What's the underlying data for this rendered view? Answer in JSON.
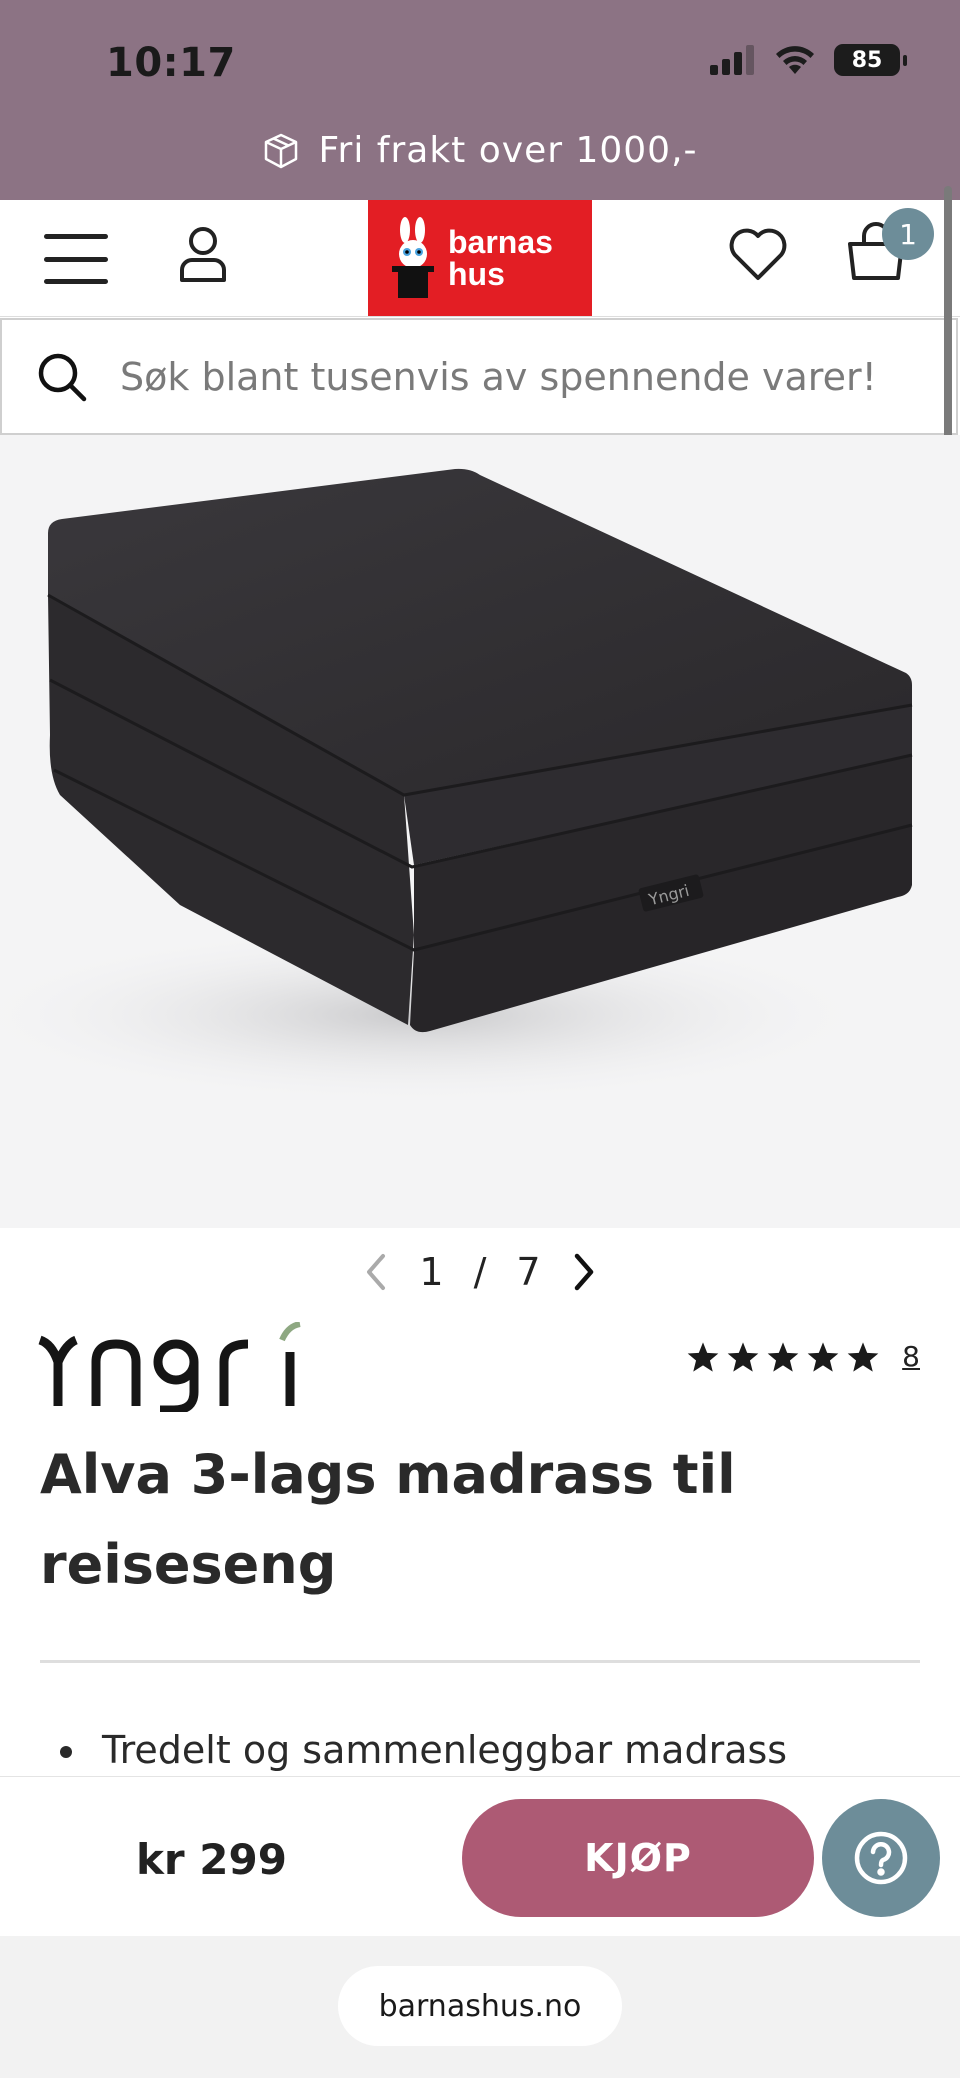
{
  "status": {
    "time": "10:17",
    "battery": "85"
  },
  "promo": {
    "text": "Fri frakt over 1000,-"
  },
  "header": {
    "logo_line1": "barnas",
    "logo_line2": "hus",
    "cart_count": "1"
  },
  "search": {
    "placeholder": "Søk blant tusenvis av spennende varer!"
  },
  "gallery": {
    "current": "1",
    "separator": "/",
    "total": "7",
    "product_label": "Yngri"
  },
  "product": {
    "brand": "Yngri",
    "title": "Alva 3-lags madrass til reiseseng",
    "rating_stars": 5,
    "rating_count": "8",
    "bullets": [
      "Tredelt og sammenleggbar madrass"
    ]
  },
  "buy": {
    "price": "kr 299",
    "button_label": "KJØP"
  },
  "browser": {
    "url": "barnashus.no"
  },
  "colors": {
    "band": "#8c7384",
    "logo_red": "#e31e24",
    "buy_button": "#ad5a74",
    "accent_teal": "#6d8d99"
  }
}
